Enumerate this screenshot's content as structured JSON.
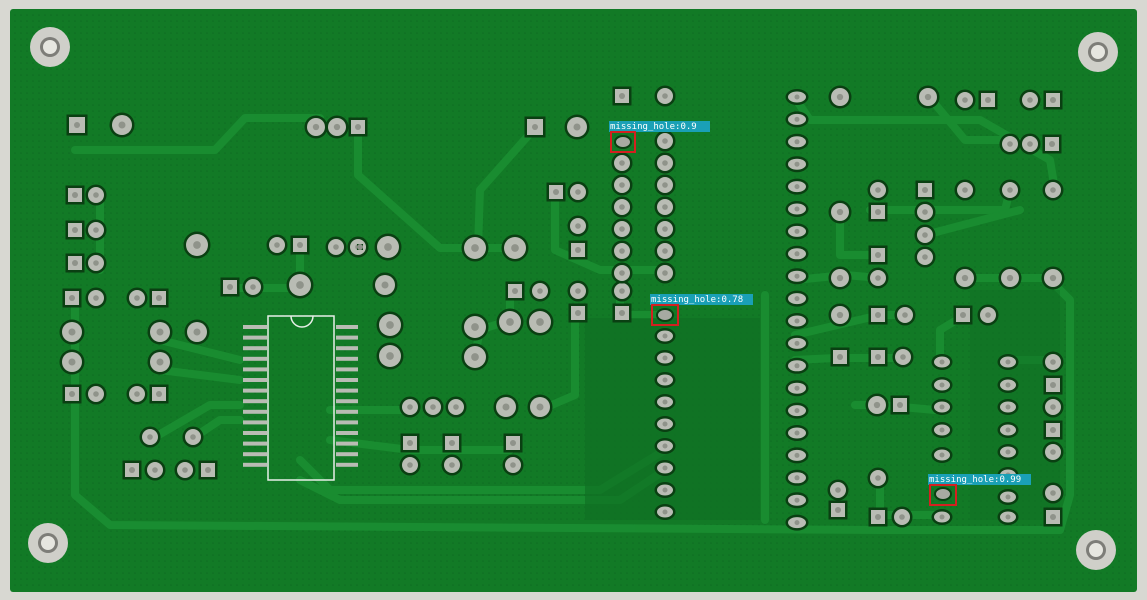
{
  "image": {
    "subject": "pcb-board",
    "colors": {
      "background": "#d8d8d2",
      "board": "#127a26",
      "board_dark": "#0c6a1f",
      "trace": "#1a8d31",
      "pad": "#b9bcb4",
      "pad_outline": "#0a3f12",
      "silkscreen": "#e8efe8",
      "box": "#d42020",
      "label_bg": "#1aa0b6"
    }
  },
  "detections": [
    {
      "label": "missing_hole:0.9"
    },
    {
      "label": "missing_hole:0.78"
    },
    {
      "label": "missing_hole:0.99"
    }
  ]
}
